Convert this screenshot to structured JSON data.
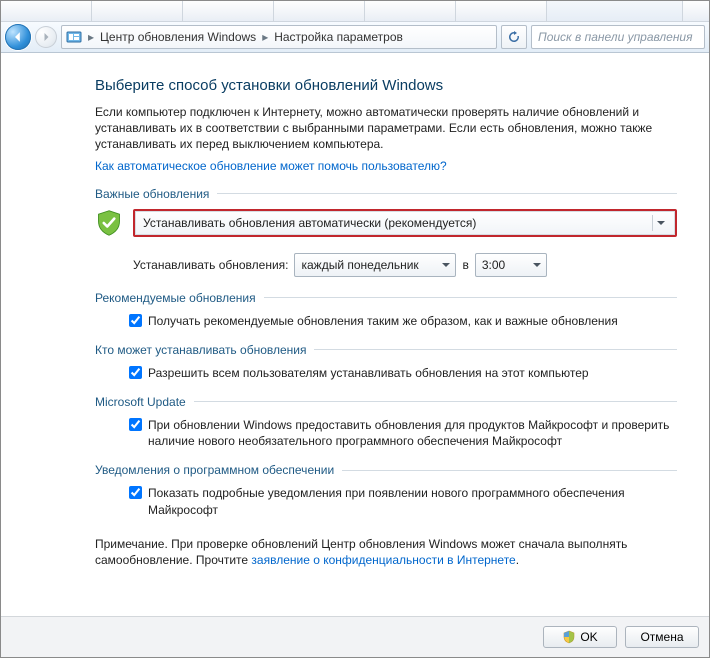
{
  "breadcrumb": {
    "root": "Центр обновления Windows",
    "page": "Настройка параметров"
  },
  "search": {
    "placeholder": "Поиск в панели управления"
  },
  "title": "Выберите способ установки обновлений Windows",
  "lead": "Если компьютер подключен к Интернету, можно автоматически проверять наличие обновлений и устанавливать их в соответствии с выбранными параметрами. Если есть обновления, можно также устанавливать их перед выключением компьютера.",
  "help_link": "Как автоматическое обновление может помочь пользователю?",
  "groups": {
    "important": {
      "legend": "Важные обновления",
      "mode_selected": "Устанавливать обновления автоматически (рекомендуется)",
      "schedule_label": "Устанавливать обновления:",
      "schedule_day": "каждый понедельник",
      "schedule_at": "в",
      "schedule_time": "3:00"
    },
    "recommended": {
      "legend": "Рекомендуемые обновления",
      "checkbox": "Получать рекомендуемые обновления таким же образом, как и важные обновления"
    },
    "who": {
      "legend": "Кто может устанавливать обновления",
      "checkbox": "Разрешить всем пользователям устанавливать обновления на этот компьютер"
    },
    "msupdate": {
      "legend": "Microsoft Update",
      "checkbox": "При обновлении Windows предоставить обновления для продуктов Майкрософт и проверить наличие нового необязательного программного обеспечения Майкрософт"
    },
    "notify": {
      "legend": "Уведомления о программном обеспечении",
      "checkbox": "Показать подробные уведомления при появлении нового программного обеспечения Майкрософт"
    }
  },
  "note_prefix": "Примечание. При проверке обновлений Центр обновления Windows может сначала выполнять самообновление. Прочтите ",
  "note_link": "заявление о конфиденциальности в Интернете",
  "note_suffix": ".",
  "footer": {
    "ok": "OK",
    "cancel": "Отмена"
  }
}
